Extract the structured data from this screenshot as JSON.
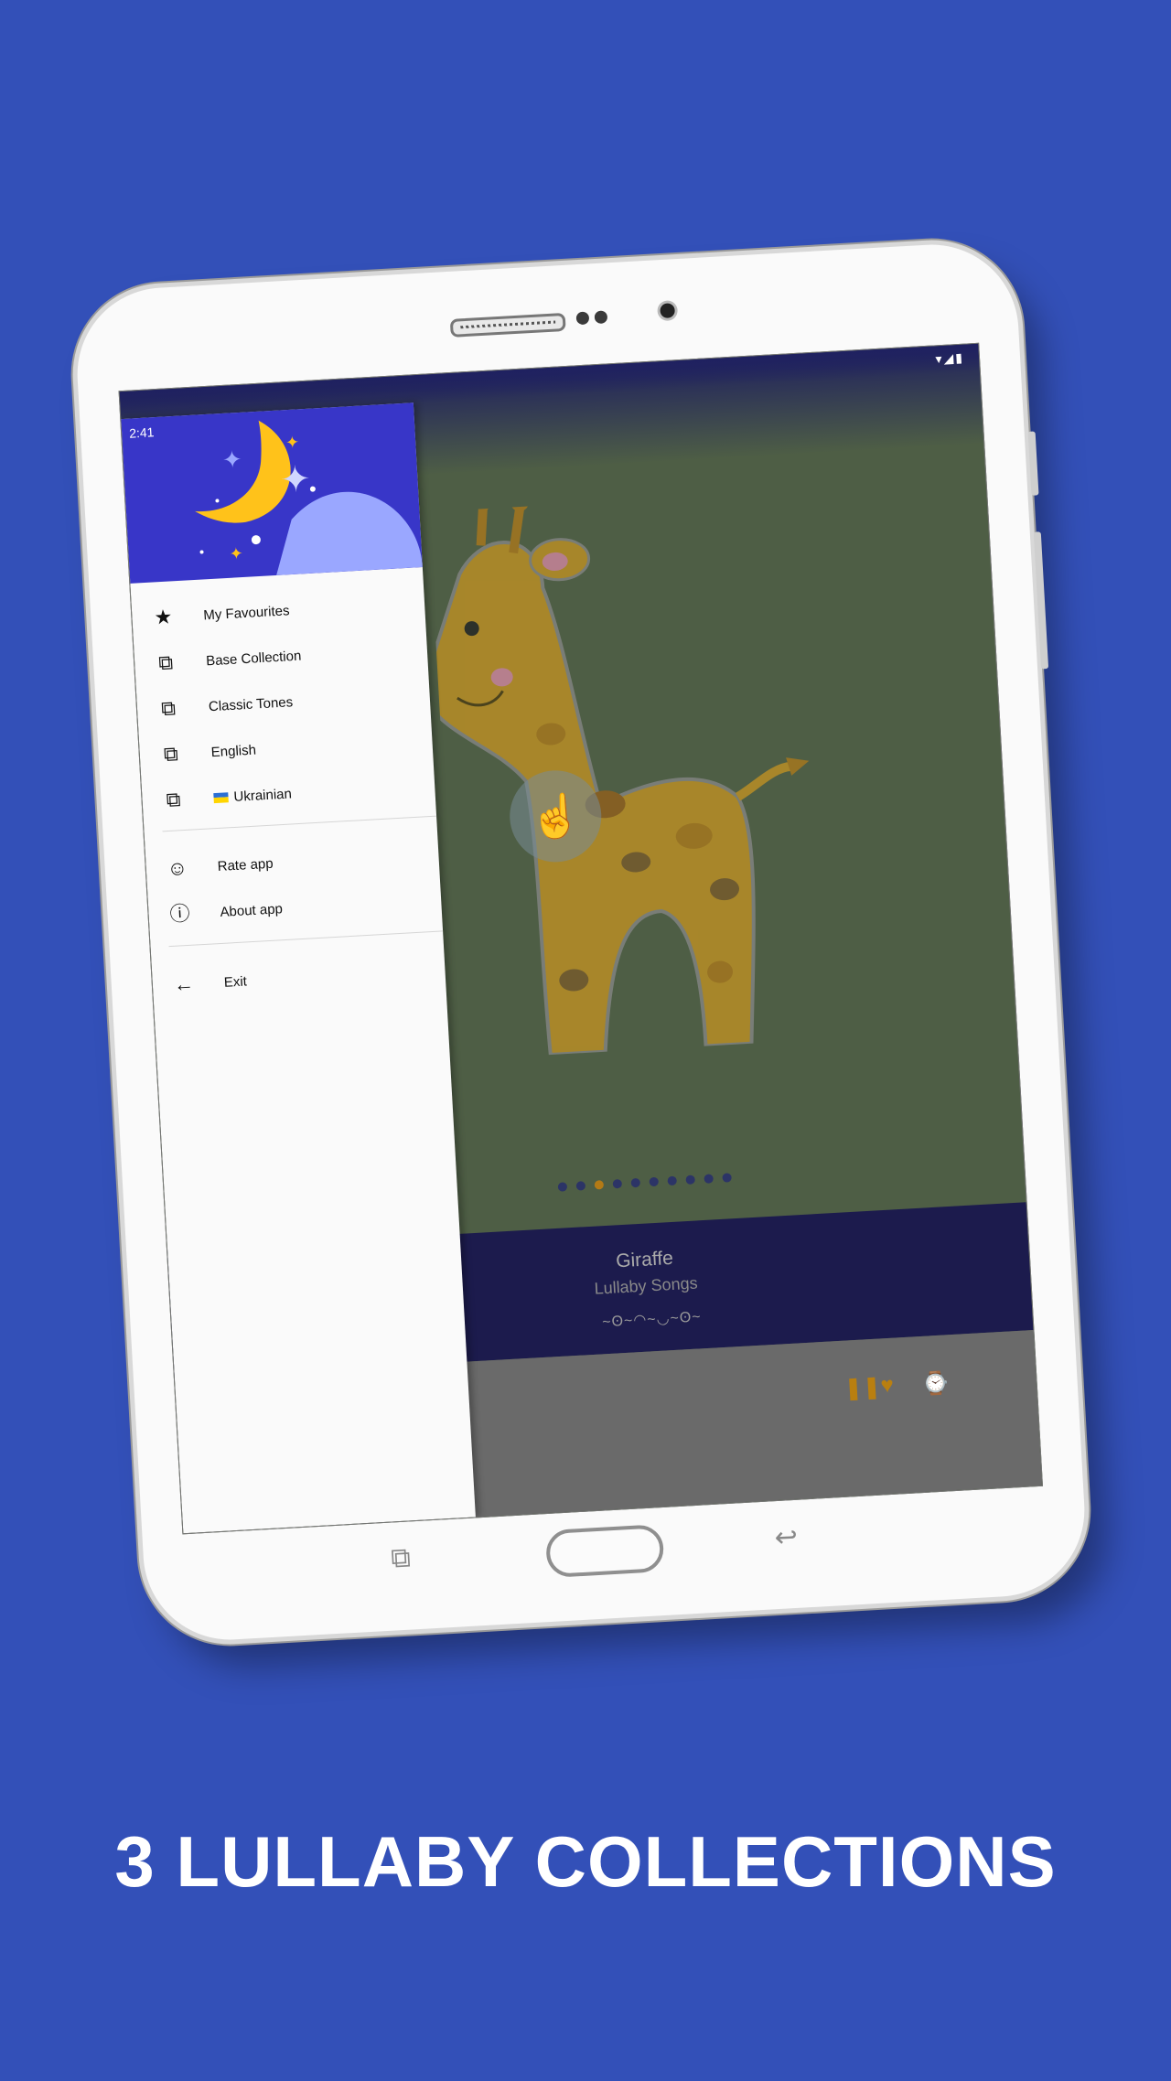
{
  "colors": {
    "background": "#3350b8",
    "drawer_header": "#3836c8",
    "accent": "#b37a16",
    "info_panel": "#1c1b4d"
  },
  "status_bar": {
    "time": "2:41",
    "icons": [
      "wifi-icon",
      "signal-icon",
      "battery-icon"
    ]
  },
  "drawer": {
    "items": [
      {
        "label": "My Favourites",
        "icon": "star-icon"
      },
      {
        "label": "Base Collection",
        "icon": "music-library-icon"
      },
      {
        "label": "Classic Tones",
        "icon": "music-library-icon"
      },
      {
        "label": "English",
        "icon": "music-library-icon"
      },
      {
        "label": "Ukrainian",
        "icon": "music-library-icon"
      },
      {
        "label": "Rate app",
        "icon": "smile-icon"
      },
      {
        "label": "About app",
        "icon": "info-icon"
      },
      {
        "label": "Exit",
        "icon": "arrow-back-icon"
      }
    ]
  },
  "player": {
    "title": "Giraffe",
    "subtitle": "Lullaby Songs",
    "page_count": 10,
    "active_page": 3,
    "controls": [
      "pause-icon",
      "heart-icon",
      "timer-off-icon"
    ]
  },
  "headline": "3 LULLABY COLLECTIONS"
}
